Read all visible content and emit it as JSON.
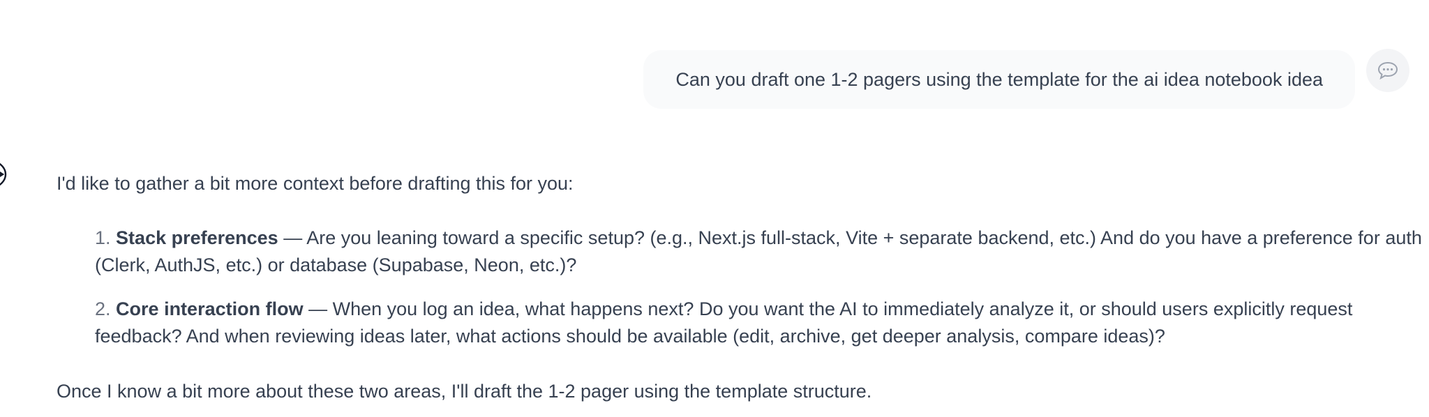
{
  "user_message": {
    "text": "Can you draft one 1-2 pagers using the template for the ai idea notebook idea",
    "avatar_icon": "chat-bubble-icon"
  },
  "assistant_message": {
    "icon": "assistant-logo-icon",
    "intro": "I'd like to gather a bit more context before drafting this for you:",
    "items": [
      {
        "number": "1.",
        "title": "Stack preferences",
        "text": " — Are you leaning toward a specific setup? (e.g., Next.js full-stack, Vite + separate backend, etc.) And do you have a preference for auth (Clerk, AuthJS, etc.) or database (Supabase, Neon, etc.)?"
      },
      {
        "number": "2.",
        "title": "Core interaction flow",
        "text": " — When you log an idea, what happens next? Do you want the AI to immediately analyze it, or should users explicitly request feedback? And when reviewing ideas later, what actions should be available (edit, archive, get deeper analysis, compare ideas)?"
      }
    ],
    "outro": "Once I know a bit more about these two areas, I'll draft the 1-2 pager using the template structure."
  }
}
